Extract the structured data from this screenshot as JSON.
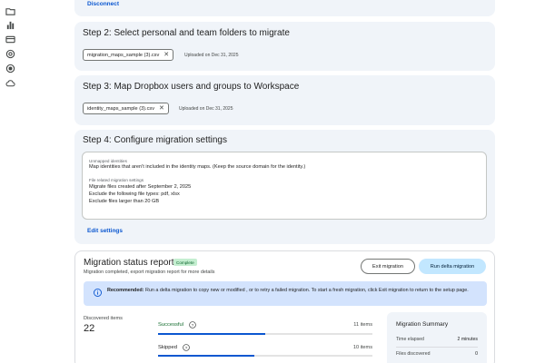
{
  "rail": {
    "icons": [
      "folder-icon",
      "bar-chart-icon",
      "card-icon",
      "at-sign-icon",
      "record-icon",
      "cloud-icon"
    ]
  },
  "step1": {
    "disconnect_label": "Disconnect"
  },
  "step2": {
    "title": "Step 2: Select personal and team folders to migrate",
    "file_name": "migration_maps_sample (3).csv",
    "uploaded": "Uploaded on Dec 31, 2025"
  },
  "step3": {
    "title": "Step 3: Map Dropbox users and groups to Workspace",
    "file_name": "identity_maps_sample (3).csv",
    "uploaded": "Uploaded on Dec 31, 2025"
  },
  "step4": {
    "title": "Step 4: Configure migration settings",
    "unmapped_label": "Unmapped identities",
    "unmapped_text": "Map identities that aren't included in the identity maps. (Keep the source domain for the identity.)",
    "file_settings_label": "File related migration settings",
    "file_settings": [
      "Migrate files created after September 2, 2025",
      "Exclude the following file types: pdf, xlsx",
      "Exclude files larger than 20 GB"
    ],
    "edit_label": "Edit settings"
  },
  "report": {
    "title": "Migration status report",
    "badge": "Complete",
    "subtitle": "Migration completed, export migration report for more details",
    "exit_label": "Exit migration",
    "delta_label": "Run delta migration",
    "notice_bold": "Recommended:",
    "notice_text": " Run a delta migration to copy new or modified , or to retry a failed migration. To start a fresh migration, click Exit migration to return to the setup page.",
    "discovered_label": "Discovered items",
    "discovered_value": "22",
    "stats": [
      {
        "label": "Successful",
        "count": "11 items",
        "color": "#146c2e",
        "fraction": 0.5
      },
      {
        "label": "Skipped",
        "count": "10 items",
        "color": "#1f1f1f",
        "fraction": 0.45
      }
    ],
    "summary": {
      "title": "Migration Summary",
      "rows": [
        {
          "label": "Time elapsed",
          "value": "2 minutes"
        },
        {
          "label": "Files discovered",
          "value": "0"
        }
      ]
    }
  },
  "colors": {
    "accent": "#0b57d0",
    "card_bg": "#f0f4f9",
    "primary_button": "#c2e7ff",
    "success": "#146c2e"
  }
}
